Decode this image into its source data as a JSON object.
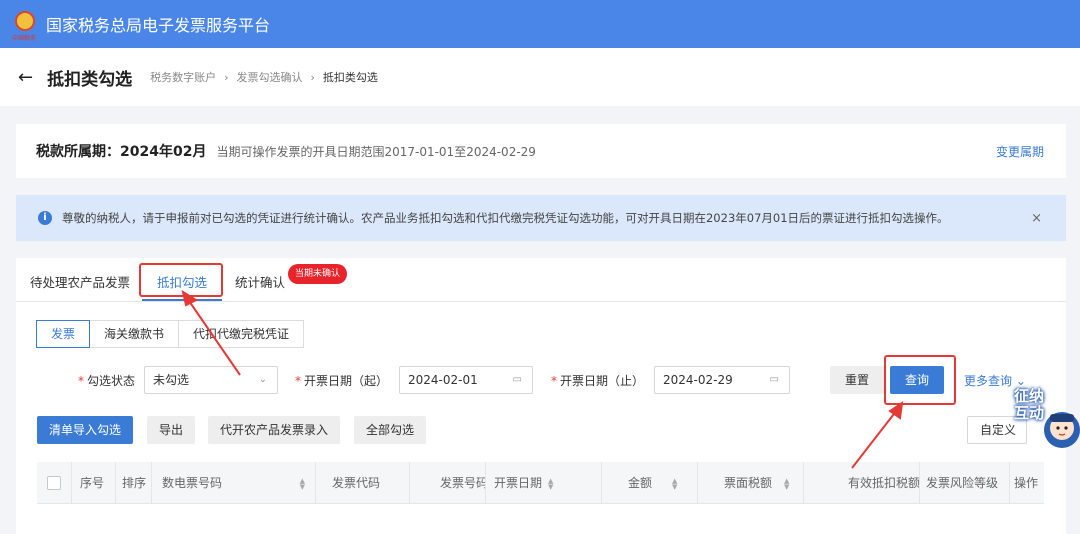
{
  "topbar": {
    "title": "国家税务总局电子发票服务平台",
    "emblem_text": "中国税务"
  },
  "header": {
    "title": "抵扣类勾选",
    "breadcrumb": [
      "税务数字账户",
      "发票勾选确认",
      "抵扣类勾选"
    ]
  },
  "period": {
    "label": "税款所属期：",
    "value": "2024年02月",
    "range_text": "当期可操作发票的开具日期范围2017-01-01至2024-02-29",
    "change_link": "变更属期"
  },
  "notice": {
    "text": "尊敬的纳税人，请于申报前对已勾选的凭证进行统计确认。农产品业务抵扣勾选和代扣代缴完税凭证勾选功能，可对开具日期在2023年07月01日后的票证进行抵扣勾选操作。",
    "close": "×"
  },
  "tabs": [
    {
      "label": "待处理农产品发票"
    },
    {
      "label": "抵扣勾选"
    },
    {
      "label": "统计确认"
    }
  ],
  "badge": "当期未确认",
  "subtabs": [
    {
      "label": "发票"
    },
    {
      "label": "海关缴款书"
    },
    {
      "label": "代扣代缴完税凭证"
    }
  ],
  "filters": {
    "status_label": "勾选状态",
    "status_value": "未勾选",
    "start_label": "开票日期（起）",
    "start_value": "2024-02-01",
    "end_label": "开票日期（止）",
    "end_value": "2024-02-29",
    "reset": "重置",
    "query": "查询",
    "more": "更多查询"
  },
  "actions": {
    "import": "清单导入勾选",
    "export": "导出",
    "agri_entry": "代开农产品发票录入",
    "select_all": "全部勾选",
    "customize": "自定义"
  },
  "table": {
    "columns": [
      "序号",
      "排序",
      "数电票号码",
      "发票代码",
      "发票号码",
      "开票日期",
      "金额",
      "票面税额",
      "有效抵扣税额",
      "发票风险等级",
      "操作"
    ]
  },
  "mascot_text": "征纳互动",
  "colors": {
    "primary": "#3a7bd5",
    "topbar": "#4a86e8",
    "highlight": "#e53935",
    "badge": "#e8232b"
  }
}
